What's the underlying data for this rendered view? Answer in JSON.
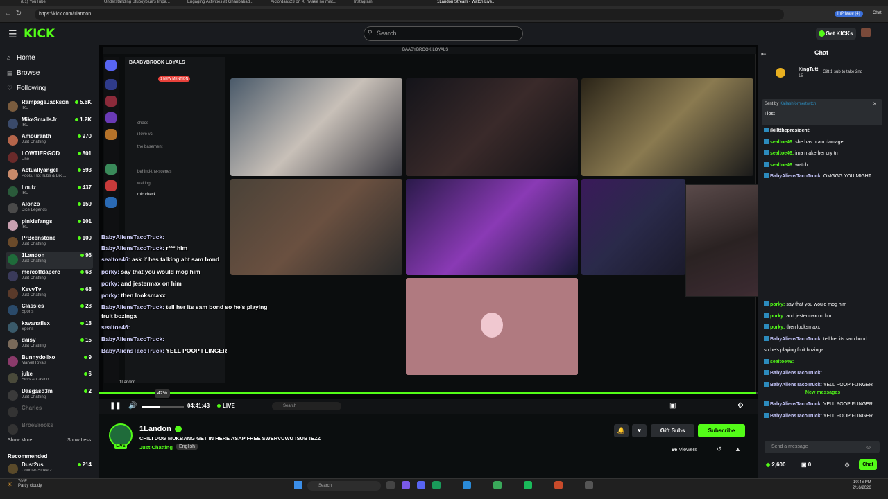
{
  "browser": {
    "tabs": [
      "(81) YouTube",
      "Understanding Stuboyblue's Impa...",
      "Engaging Activities at Gharibabad...",
      "Aiclordans23 on X: \"Make no mist...",
      "Instagram",
      "1Landon Stream - Watch Live..."
    ],
    "url": "https://kick.com/1landon",
    "inprivate": "InPrivate (4)",
    "chat_btn": "Chat"
  },
  "header": {
    "logo": "KICK",
    "search_placeholder": "Search",
    "get_kicks": "Get KICKs"
  },
  "sidebar": {
    "nav": [
      {
        "label": "Home",
        "icon": "home-icon"
      },
      {
        "label": "Browse",
        "icon": "browse-icon"
      },
      {
        "label": "Following",
        "icon": "heart-icon"
      }
    ],
    "channels": [
      {
        "name": "RampageJackson",
        "category": "IRL",
        "viewers": "5.6K",
        "color": "#7a5c3e"
      },
      {
        "name": "MikeSmallsJr",
        "category": "IRL",
        "viewers": "1.2K",
        "color": "#3a4a6a"
      },
      {
        "name": "Amouranth",
        "category": "Just Chatting",
        "viewers": "970",
        "color": "#b5654a"
      },
      {
        "name": "LOWTIERGOD",
        "category": "Uno",
        "viewers": "801",
        "color": "#6a2a2a"
      },
      {
        "name": "Actuallyangel",
        "category": "Pools, Hot Tubs & Biki...",
        "viewers": "593",
        "color": "#c98a6a"
      },
      {
        "name": "Louiz",
        "category": "IRL",
        "viewers": "437",
        "color": "#2a5a3a"
      },
      {
        "name": "Alonzo",
        "category": "Dice Legends",
        "viewers": "159",
        "color": "#4a4a4a"
      },
      {
        "name": "pinkiefangs",
        "category": "IRL",
        "viewers": "101",
        "color": "#c8a0b0"
      },
      {
        "name": "PrBeenstone",
        "category": "Just Chatting",
        "viewers": "100",
        "color": "#6a4a2a"
      },
      {
        "name": "1Landon",
        "category": "Just Chatting",
        "viewers": "96",
        "color": "#1f6b3a"
      },
      {
        "name": "mercoffdaperc",
        "category": "Just Chatting",
        "viewers": "68",
        "color": "#3a3a5a"
      },
      {
        "name": "KevvTv",
        "category": "Just Chatting",
        "viewers": "68",
        "color": "#5a3a2a"
      },
      {
        "name": "Classics",
        "category": "Sports",
        "viewers": "28",
        "color": "#2a4a6a"
      },
      {
        "name": "kavanaflex",
        "category": "Sports",
        "viewers": "18",
        "color": "#3a5a6a"
      },
      {
        "name": "daisy",
        "category": "Just Chatting",
        "viewers": "15",
        "color": "#7a6a5a"
      },
      {
        "name": "Bunnydollxo",
        "category": "Marvel Rivals",
        "viewers": "9",
        "color": "#8a3a6a"
      },
      {
        "name": "juke",
        "category": "Slots & Casino",
        "viewers": "6",
        "color": "#4a4a3a"
      },
      {
        "name": "Dasgasd3m",
        "category": "Just Chatting",
        "viewers": "2",
        "color": "#3a3a3a"
      },
      {
        "name": "Charles",
        "category": "",
        "viewers": "",
        "color": "#333333"
      },
      {
        "name": "BroeBrooks",
        "category": "",
        "viewers": "",
        "color": "#333333"
      }
    ],
    "show_more": "Show More",
    "show_less": "Show Less",
    "recommended": "Recommended",
    "recommended_channels": [
      {
        "name": "Dust2us",
        "category": "Counter-Strike 2",
        "viewers": "214",
        "color": "#5a4a2a"
      }
    ]
  },
  "discord": {
    "window_title": "BAABYBROOK LOYALS",
    "server_name": "BAABYBROOK LOYALS",
    "mention": "1 NEW MENTION",
    "channels": [
      "chaos",
      "i love vc",
      "the basement",
      "behind-the-scenes",
      "waiting",
      "mic check"
    ],
    "user": "1Landon"
  },
  "overlay_chat": [
    {
      "user": "BabyAliensTacoTruck:",
      "text": ""
    },
    {
      "user": "BabyAliensTacoTruck:",
      "text": "r*** him"
    },
    {
      "user": "sealtoe46:",
      "text": "ask if hes talking abt sam bond"
    },
    {
      "user": "porky:",
      "text": "say that you would mog him"
    },
    {
      "user": "porky:",
      "text": "and jestermax on him"
    },
    {
      "user": "porky:",
      "text": "then looksmaxx"
    },
    {
      "user": "BabyAliensTacoTruck:",
      "text": "tell her its sam bond so he's playing"
    },
    {
      "user": "",
      "text": "fruit bozinga"
    },
    {
      "user": "sealtoe46:",
      "text": ""
    },
    {
      "user": "BabyAliensTacoTruck:",
      "text": ""
    },
    {
      "user": "BabyAliensTacoTruck:",
      "text": "YELL POOP FLINGER"
    }
  ],
  "player": {
    "volume": "42%",
    "volume_level": 0.42,
    "time": "04:41:43",
    "live": "LIVE",
    "taskbar_search": "Search"
  },
  "stream": {
    "name": "1Landon",
    "title": "CHILI DOG MUKBANG GET IN HERE ASAP FREE SWERVUWU !SUB !EZZ",
    "category": "Just Chatting",
    "language": "English",
    "live_badge": "LIVE",
    "viewers": "96",
    "viewers_label": "Viewers",
    "gift_subs": "Gift Subs",
    "subscribe": "Subscribe"
  },
  "chat": {
    "title": "Chat",
    "top_gifter": {
      "name": "KingTutt",
      "count": "15",
      "action": "Gift 1 sub to take 2nd"
    },
    "pinned": {
      "sent_by": "Sent by",
      "sender": "Kailashformertwitch",
      "text": "I lost"
    },
    "messages": [
      {
        "user": "ikilltthepresident:",
        "text": "",
        "color": "#ffffff"
      },
      {
        "user": "sealtoe46:",
        "text": "she has brain damage",
        "color": "#53fc18"
      },
      {
        "user": "sealtoe46:",
        "text": "ima make her cry tn",
        "color": "#53fc18"
      },
      {
        "user": "sealtoe46:",
        "text": "watch",
        "color": "#53fc18"
      },
      {
        "user": "BabyAliensTacoTruck:",
        "text": "OMGGG YOU MIGHT",
        "color": "#c9c9ff"
      }
    ],
    "messages_lower": [
      {
        "user": "porky:",
        "text": "say that you would mog him",
        "color": "#53fc18"
      },
      {
        "user": "porky:",
        "text": "and jestermax on him",
        "color": "#53fc18"
      },
      {
        "user": "porky:",
        "text": "then looksmaxx",
        "color": "#53fc18"
      },
      {
        "user": "BabyAliensTacoTruck:",
        "text": "tell her its sam bond",
        "color": "#c9c9ff"
      },
      {
        "user": "",
        "text": "so he's playing fruit bozinga",
        "color": "#ffffff"
      },
      {
        "user": "sealtoe46:",
        "text": "",
        "color": "#53fc18"
      },
      {
        "user": "BabyAliensTacoTruck:",
        "text": "",
        "color": "#c9c9ff"
      },
      {
        "user": "BabyAliensTacoTruck:",
        "text": "YELL POOP FLINGER",
        "color": "#c9c9ff"
      }
    ],
    "new_messages": "New messages",
    "messages_new": [
      {
        "user": "BabyAliensTacoTruck:",
        "text": "YELL POOP FLINGER",
        "color": "#c9c9ff"
      },
      {
        "user": "BabyAliensTacoTruck:",
        "text": "YELL POOP FLINGER",
        "color": "#c9c9ff"
      }
    ],
    "send_placeholder": "Send a message",
    "kicks": "2,600",
    "count2": "0",
    "chat_button": "Chat"
  },
  "taskbar": {
    "weather_temp": "70°F",
    "weather_desc": "Partly cloudy",
    "search": "Search",
    "time": "10:46 PM",
    "date": "2/16/2026"
  },
  "colors": {
    "accent": "#53fc18",
    "bg": "#0b0e0f",
    "panel": "#191b1f"
  }
}
